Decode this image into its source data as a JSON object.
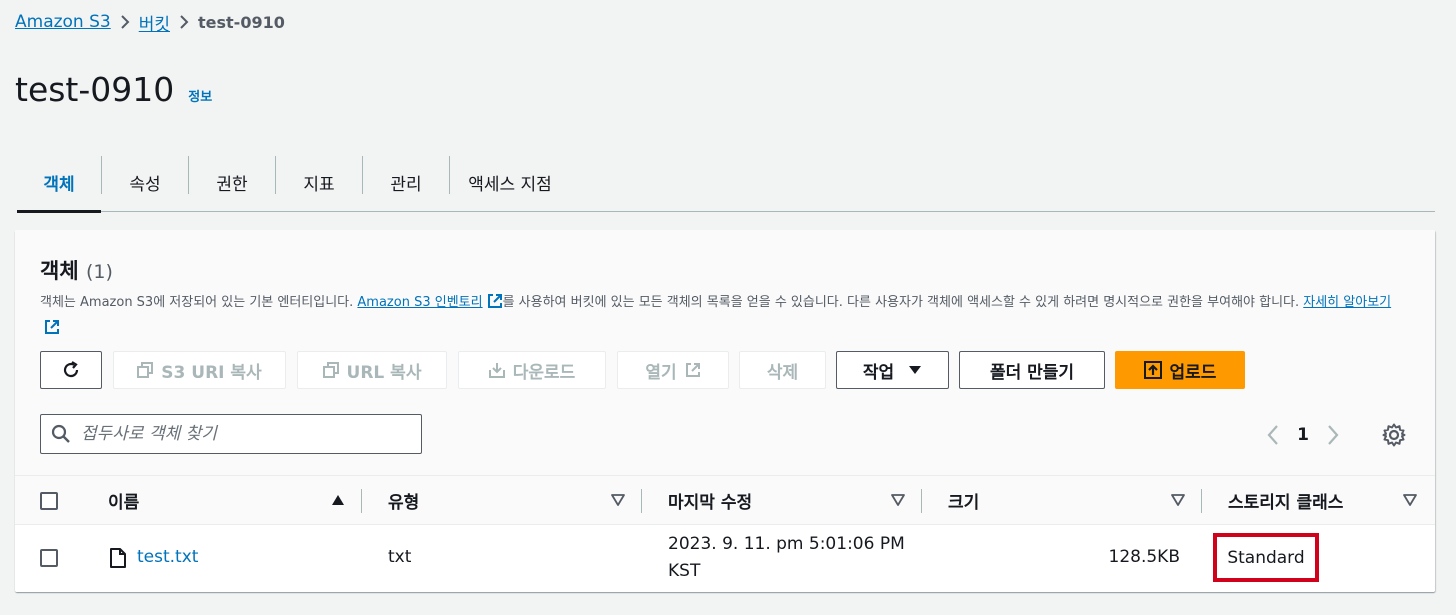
{
  "breadcrumb": {
    "root": "Amazon S3",
    "buckets": "버킷",
    "current": "test-0910"
  },
  "page": {
    "title": "test-0910",
    "info": "정보"
  },
  "tabs": [
    {
      "label": "객체",
      "active": true
    },
    {
      "label": "속성",
      "active": false
    },
    {
      "label": "권한",
      "active": false
    },
    {
      "label": "지표",
      "active": false
    },
    {
      "label": "관리",
      "active": false
    },
    {
      "label": "액세스 지점",
      "active": false
    }
  ],
  "panel": {
    "title": "객체",
    "count": "(1)",
    "desc_part1": "객체는 Amazon S3에 저장되어 있는 기본 엔터티입니다. ",
    "desc_link1": "Amazon S3 인벤토리",
    "desc_part2": "를 사용하여 버킷에 있는 모든 객체의 목록을 얻을 수 있습니다. 다른 사용자가 객체에 액세스할 수 있게 하려면 명시적으로 권한을 부여해야 합니다. ",
    "desc_link2": "자세히 알아보기"
  },
  "toolbar": {
    "copy_s3_uri": "S3 URI 복사",
    "copy_url": "URL 복사",
    "download": "다운로드",
    "open": "열기",
    "delete": "삭제",
    "actions": "작업",
    "create_folder": "폴더 만들기",
    "upload": "업로드"
  },
  "search": {
    "placeholder": "접두사로 객체 찾기"
  },
  "pagination": {
    "current_page": "1"
  },
  "table": {
    "columns": [
      "이름",
      "유형",
      "마지막 수정",
      "크기",
      "스토리지 클래스"
    ],
    "rows": [
      {
        "name": "test.txt",
        "type": "txt",
        "modified_line1": "2023. 9. 11. pm 5:01:06 PM",
        "modified_line2": "KST",
        "size": "128.5KB",
        "storage_class": "Standard"
      }
    ]
  },
  "colors": {
    "link": "#0073bb",
    "primary": "#ff9900",
    "highlight": "#d0021b"
  }
}
